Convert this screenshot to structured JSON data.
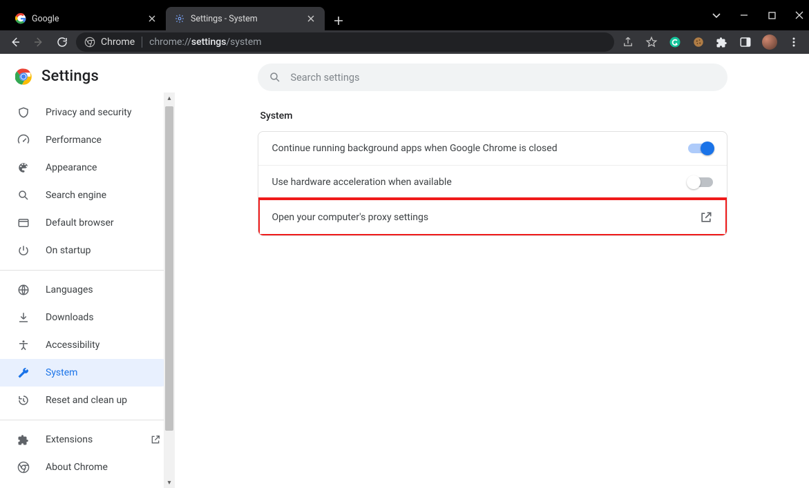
{
  "window": {
    "tabs": [
      {
        "title": "Google",
        "favicon": "google"
      },
      {
        "title": "Settings - System",
        "favicon": "gear"
      }
    ],
    "active_tab": 1
  },
  "toolbar": {
    "chrome_label": "Chrome",
    "url_prefix": "chrome://",
    "url_bold": "settings",
    "url_suffix": "/system"
  },
  "settings": {
    "title": "Settings",
    "search_placeholder": "Search settings",
    "section_title": "System",
    "rows": {
      "bg_apps": "Continue running background apps when Google Chrome is closed",
      "hw_accel": "Use hardware acceleration when available",
      "proxy": "Open your computer's proxy settings"
    },
    "toggles": {
      "bg_apps": true,
      "hw_accel": false
    }
  },
  "sidebar": {
    "items": [
      {
        "label": "Privacy and security"
      },
      {
        "label": "Performance"
      },
      {
        "label": "Appearance"
      },
      {
        "label": "Search engine"
      },
      {
        "label": "Default browser"
      },
      {
        "label": "On startup"
      }
    ],
    "advanced": [
      {
        "label": "Languages"
      },
      {
        "label": "Downloads"
      },
      {
        "label": "Accessibility"
      },
      {
        "label": "System"
      },
      {
        "label": "Reset and clean up"
      }
    ],
    "footer": [
      {
        "label": "Extensions"
      },
      {
        "label": "About Chrome"
      }
    ],
    "active": "System"
  }
}
